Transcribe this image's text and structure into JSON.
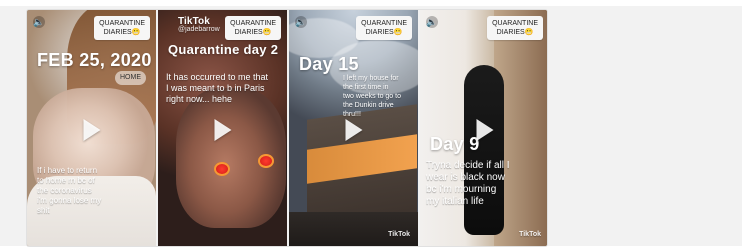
{
  "cards": [
    {
      "badge": "QUARANTINE\nDIARIES😬",
      "title": "FEB 25, 2020",
      "home": "HOME",
      "caption": "If i have to return\nto home rn bc of\nthe coronavirus\ni'm gonna lose my\nshit",
      "icons": {
        "mute": "volume-icon",
        "play": "play-icon"
      }
    },
    {
      "tiktok": "TikTok",
      "handle": "@jadebarrow",
      "badge": "QUARANTINE\nDIARIES😬",
      "title": "Quarantine day 2",
      "caption": "It has occurred to me that\nI was meant to b in Paris\nright now... hehe",
      "icons": {
        "logo": "tiktok-logo-icon",
        "play": "play-icon"
      }
    },
    {
      "badge": "QUARANTINE\nDIARIES😬",
      "title": "Day 15",
      "caption": "I left my house for\nthe first time in\ntwo weeks to go to\nthe Dunkin drive\nthru!!!",
      "corner": "TikTok",
      "icons": {
        "mute": "volume-icon",
        "play": "play-icon"
      }
    },
    {
      "badge": "QUARANTINE\nDIARIES😬",
      "title": "Day 9",
      "caption": "Tryna decide if all I\nwear is black now\nbc i'm mourning\nmy italian life",
      "corner": "TikTok",
      "icons": {
        "mute": "volume-icon",
        "play": "play-icon"
      }
    }
  ]
}
